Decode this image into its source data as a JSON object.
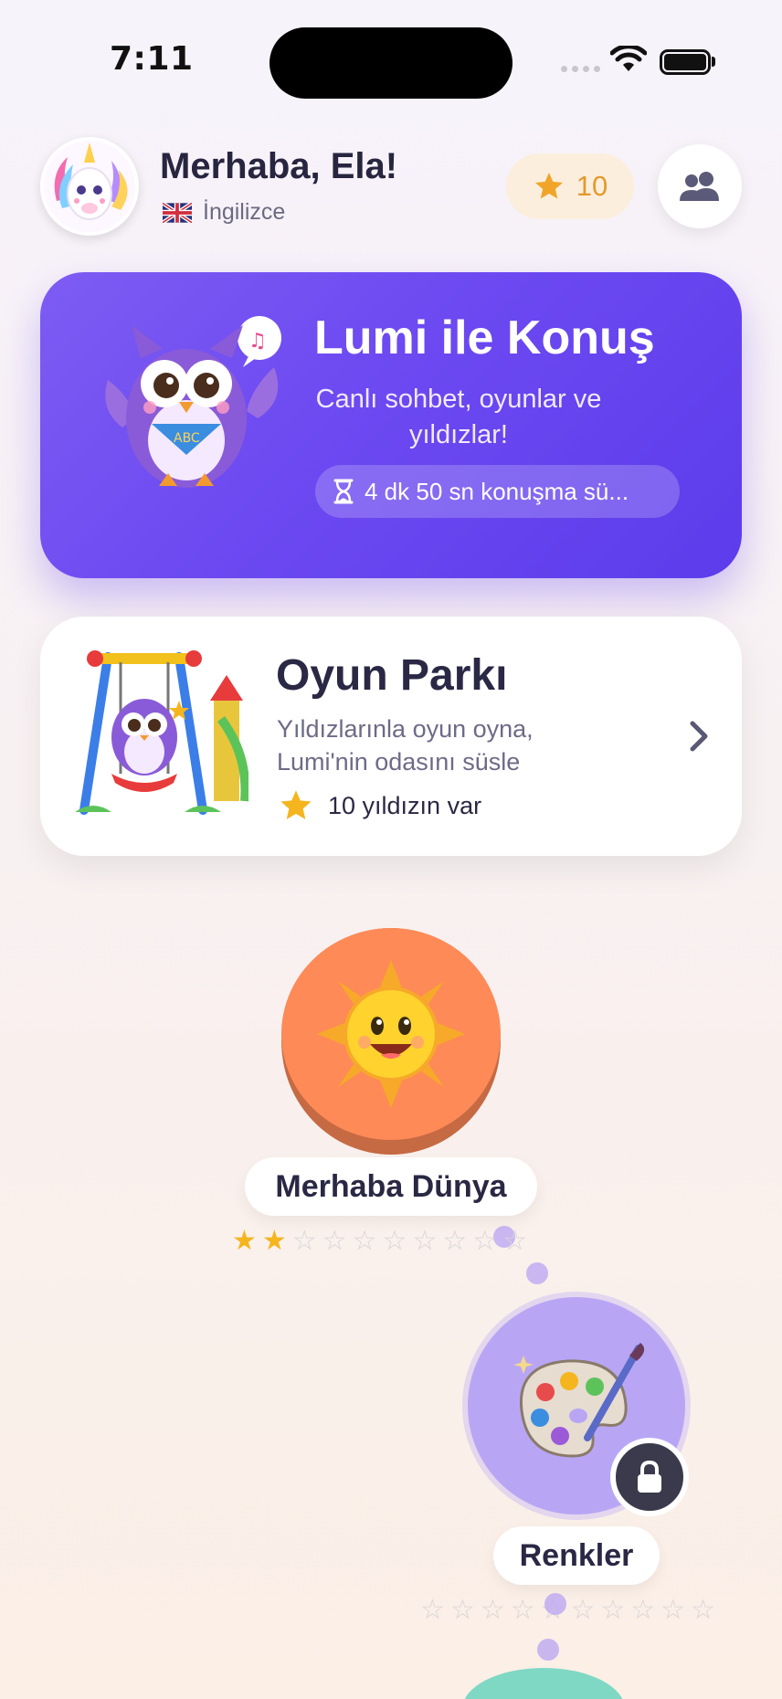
{
  "status_bar": {
    "time": "7:11"
  },
  "header": {
    "greeting": "Merhaba, Ela!",
    "language": "İngilizce",
    "star_count": "10"
  },
  "lumi_card": {
    "title": "Lumi ile Konuş",
    "subtitle": "Canlı sohbet, oyunlar ve yıldızlar!",
    "time_remaining": "4 dk 50 sn konuşma sü..."
  },
  "park_card": {
    "title": "Oyun Parkı",
    "subtitle": "Yıldızlarınla oyun oyna, Lumi'nin odasını süsle",
    "stars_text": "10 yıldızın var"
  },
  "lessons": [
    {
      "title": "Merhaba Dünya",
      "stars_earned": 2,
      "stars_total": 10,
      "locked": false,
      "icon": "sun-icon",
      "color": "#fd8a57"
    },
    {
      "title": "Renkler",
      "stars_earned": 0,
      "stars_total": 10,
      "locked": true,
      "icon": "palette-icon",
      "color": "#b8a6f5"
    }
  ],
  "colors": {
    "primary": "#6c49f1",
    "star": "#f5b51f",
    "text_dark": "#2a2844"
  }
}
